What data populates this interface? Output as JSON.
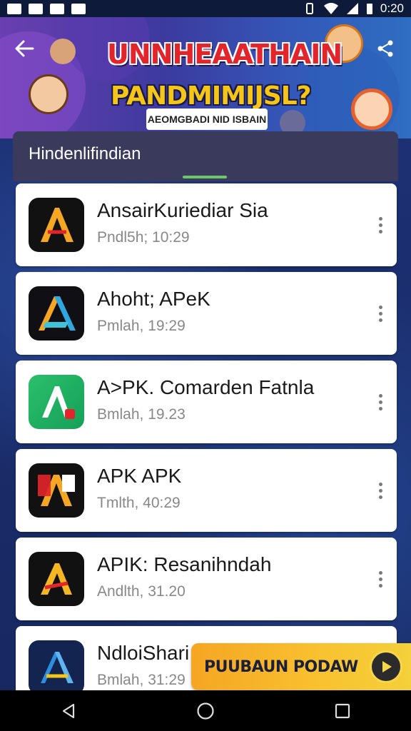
{
  "status_bar": {
    "time": "0:20"
  },
  "banner": {
    "title_line1": "UNNHEAATHAIN",
    "title_line2": "PANDMIMIJSL?",
    "subtitle": "AEOMGBADI NID ISBAIN"
  },
  "list_header": {
    "title": "Hindenlifindian"
  },
  "apps": [
    {
      "name": "AnsairKuriediar Sia",
      "meta": "Pndl5h; 10:29",
      "icon": "app-a-orange-icon"
    },
    {
      "name": "Ahoht; APeK",
      "meta": "Pmlah, 19:29",
      "icon": "app-a-rainbow-icon"
    },
    {
      "name": "A>PK. Comarden Fatnla",
      "meta": "Bmlah, 19.23",
      "icon": "app-a-green-icon"
    },
    {
      "name": "APK APK",
      "meta": "Tmlth, 40:29",
      "icon": "app-pa-icon"
    },
    {
      "name": "APIK: Resanihndah",
      "meta": "Andlth, 31.20",
      "icon": "app-a-gold-icon"
    },
    {
      "name": "NdloiShari",
      "meta": "Bmlah, 31:29",
      "icon": "app-a-blue-icon"
    }
  ],
  "promo": {
    "label": "PUUBAUN PODAW"
  },
  "colors": {
    "header_bg": "#3a3a5c",
    "tab_indicator": "#6cc66c",
    "promo_bg": "#f8c230"
  }
}
